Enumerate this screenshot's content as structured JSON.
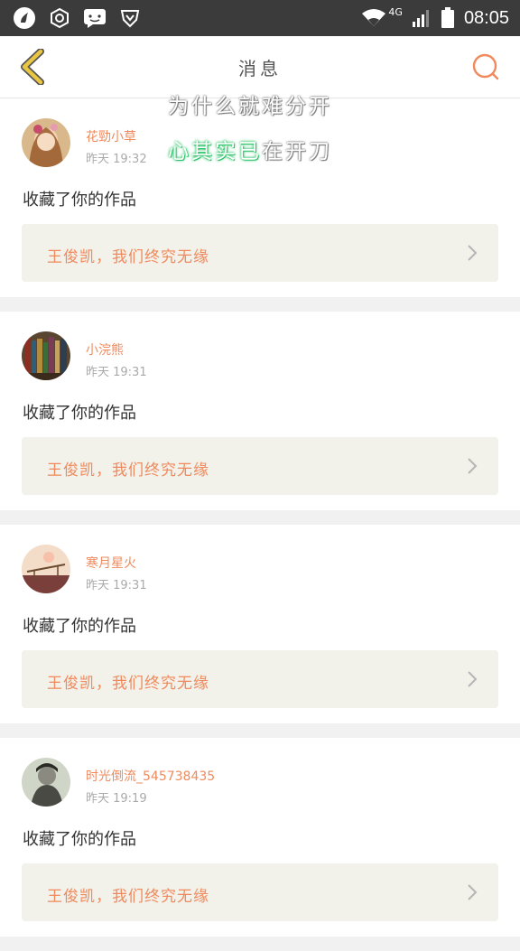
{
  "status_bar": {
    "network_label": "4G",
    "time": "08:05"
  },
  "header": {
    "title": "消息"
  },
  "overlay": {
    "line1": "为什么就难分开",
    "line2_highlight": "心其实已",
    "line2_rest": "在开刀"
  },
  "messages": [
    {
      "username": "花勁小草",
      "time": "昨天 19:32",
      "action": "收藏了你的作品",
      "work_title": "王俊凯，我们终究无缘"
    },
    {
      "username": "小浣熊",
      "time": "昨天 19:31",
      "action": "收藏了你的作品",
      "work_title": "王俊凯，我们终究无缘"
    },
    {
      "username": "寒月星火",
      "time": "昨天 19:31",
      "action": "收藏了你的作品",
      "work_title": "王俊凯，我们终究无缘"
    },
    {
      "username": "时光倒流_545738435",
      "time": "昨天 19:19",
      "action": "收藏了你的作品",
      "work_title": "王俊凯，我们终究无缘"
    }
  ],
  "colors": {
    "accent": "#f08a5d",
    "back_arrow": "#e8c542",
    "status_bar": "#3b3b3b",
    "card_link_bg": "#f2f1ea",
    "highlight_green": "#2ec46a"
  },
  "icons": {
    "back": "back-arrow-icon",
    "search": "search-icon"
  }
}
